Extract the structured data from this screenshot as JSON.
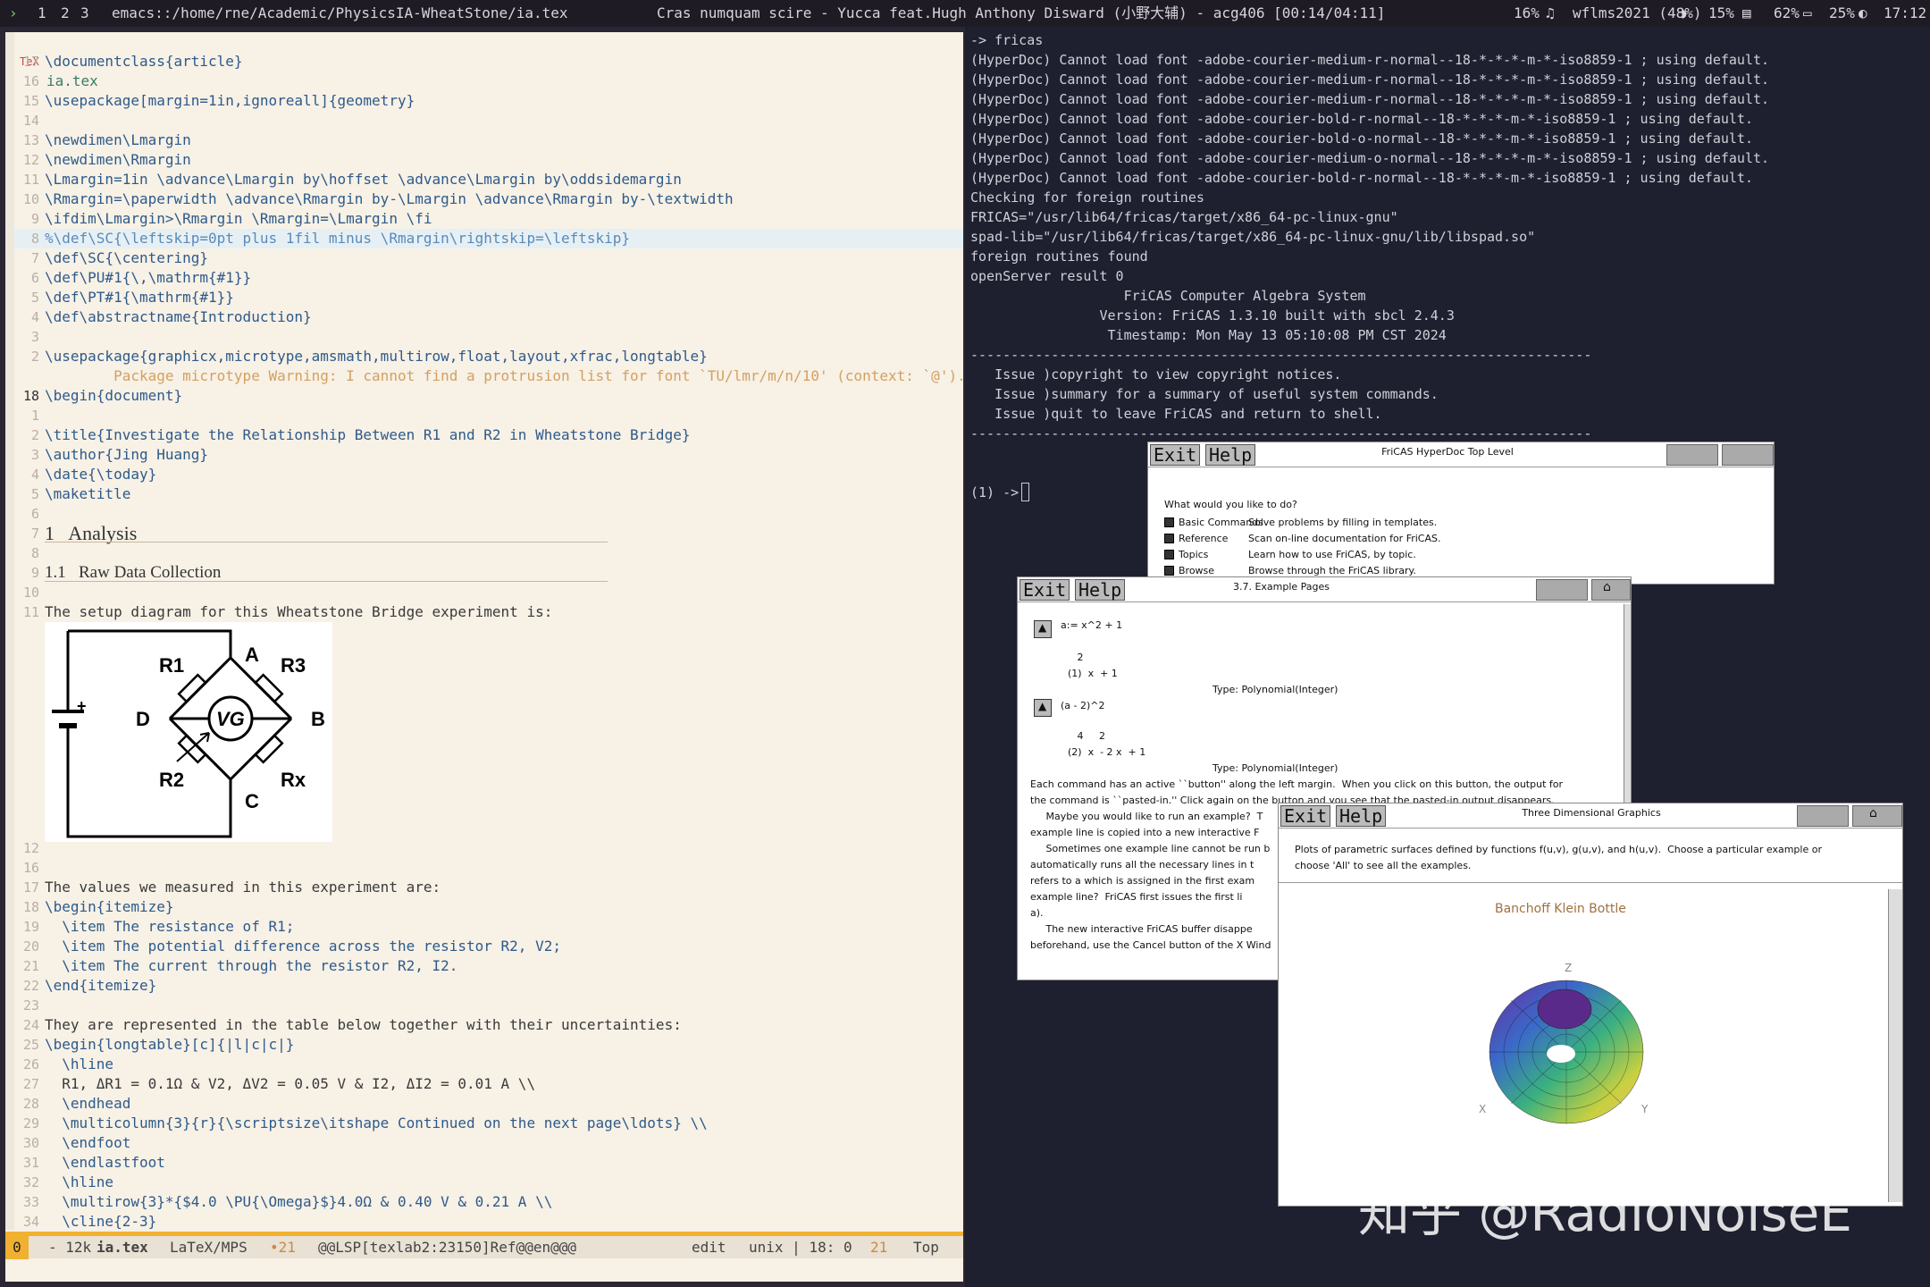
{
  "topbar": {
    "workspaces": [
      "1",
      "2",
      "3"
    ],
    "path": "emacs::/home/rne/Academic/PhysicsIA-WheatStone/ia.tex",
    "song": "Cras numquam scire - Yucca feat.Hugh Anthony Disward (小野大辅) - acg406 [00:14/04:11]",
    "cpu": "16%",
    "wifi": "wflms2021 (48%)",
    "disk": "15%",
    "battery": "62%",
    "bright": "25%",
    "clock": "17:12"
  },
  "editor": {
    "header": {
      "icon": "TeX",
      "filename": "ia.tex"
    },
    "lines": [
      {
        "n": "17",
        "t": "\\documentclass{article}"
      },
      {
        "n": "16",
        "t": ""
      },
      {
        "n": "15",
        "t": "\\usepackage[margin=1in,ignoreall]{geometry}"
      },
      {
        "n": "14",
        "t": ""
      },
      {
        "n": "13",
        "t": "\\newdimen\\Lmargin"
      },
      {
        "n": "12",
        "t": "\\newdimen\\Rmargin"
      },
      {
        "n": "11",
        "t": "\\Lmargin=1in \\advance\\Lmargin by\\hoffset \\advance\\Lmargin by\\oddsidemargin"
      },
      {
        "n": "10",
        "t": "\\Rmargin=\\paperwidth \\advance\\Rmargin by-\\Lmargin \\advance\\Rmargin by-\\textwidth"
      },
      {
        "n": "9",
        "t": "\\ifdim\\Lmargin>\\Rmargin \\Rmargin=\\Lmargin \\fi"
      },
      {
        "n": "8",
        "t": "%\\def\\SC{\\leftskip=0pt plus 1fil minus \\Rmargin\\rightskip=\\leftskip}"
      },
      {
        "n": "7",
        "t": "\\def\\SC{\\centering}"
      },
      {
        "n": "6",
        "t": "\\def\\PU#1{\\,\\mathrm{#1}}"
      },
      {
        "n": "5",
        "t": "\\def\\PT#1{\\mathrm{#1}}"
      },
      {
        "n": "4",
        "t": "\\def\\abstractname{Introduction}"
      },
      {
        "n": "3",
        "t": ""
      },
      {
        "n": "2",
        "t": "\\usepackage{graphicx,microtype,amsmath,multirow,float,layout,xfrac,longtable}"
      },
      {
        "n": "",
        "t": "        Package microtype Warning: I cannot find a protrusion list for font `TU/lmr/m/n/10' (context: `@')."
      },
      {
        "n": "18",
        "t": "\\begin{document}"
      },
      {
        "n": "1",
        "t": ""
      },
      {
        "n": "2",
        "t": "\\title{Investigate the Relationship Between R1 and R2 in Wheatstone Bridge}"
      },
      {
        "n": "3",
        "t": "\\author{Jing Huang}"
      },
      {
        "n": "4",
        "t": "\\date{\\today}"
      },
      {
        "n": "5",
        "t": "\\maketitle"
      },
      {
        "n": "6",
        "t": ""
      },
      {
        "n": "7",
        "t": "1   Analysis"
      },
      {
        "n": "8",
        "t": ""
      },
      {
        "n": "9",
        "t": "1.1   Raw Data Collection"
      },
      {
        "n": "10",
        "t": ""
      },
      {
        "n": "11",
        "t": "The setup diagram for this Wheatstone Bridge experiment is:"
      }
    ],
    "lines2": [
      {
        "n": "12",
        "t": ""
      },
      {
        "n": "16",
        "t": ""
      },
      {
        "n": "17",
        "t": "The values we measured in this experiment are:"
      },
      {
        "n": "18",
        "t": "\\begin{itemize}"
      },
      {
        "n": "19",
        "t": "  \\item The resistance of R1;"
      },
      {
        "n": "20",
        "t": "  \\item The potential difference across the resistor R2, V2;"
      },
      {
        "n": "21",
        "t": "  \\item The current through the resistor R2, I2."
      },
      {
        "n": "22",
        "t": "\\end{itemize}"
      },
      {
        "n": "23",
        "t": ""
      },
      {
        "n": "24",
        "t": "They are represented in the table below together with their uncertainties:"
      },
      {
        "n": "25",
        "t": "\\begin{longtable}[c]{|l|c|c|}"
      },
      {
        "n": "26",
        "t": "  \\hline"
      },
      {
        "n": "27",
        "t": "  R1, ΔR1 = 0.1Ω & V2, ΔV2 = 0.05 V & I2, ΔI2 = 0.01 A \\\\"
      },
      {
        "n": "28",
        "t": "  \\endhead"
      },
      {
        "n": "29",
        "t": "  \\multicolumn{3}{r}{\\scriptsize\\itshape Continued on the next page\\ldots} \\\\"
      },
      {
        "n": "30",
        "t": "  \\endfoot"
      },
      {
        "n": "31",
        "t": "  \\endlastfoot"
      },
      {
        "n": "32",
        "t": "  \\hline"
      },
      {
        "n": "33",
        "t": "  \\multirow{3}*{$4.0 \\PU{\\Omega}$}4.0Ω & 0.40 V & 0.21 A \\\\"
      },
      {
        "n": "34",
        "t": "  \\cline{2-3}"
      }
    ],
    "circuit": {
      "labels": [
        "R1",
        "R3",
        "D",
        "B",
        "VG",
        "R2",
        "Rx",
        "A",
        "C",
        "+"
      ]
    },
    "modeline": {
      "state": "0",
      "size": "- 12k",
      "file": "ia.tex",
      "mode": "LaTeX/MPS",
      "count": "•21",
      "lsp": "@@LSP[texlab2:23150]Ref@@en@@@",
      "edit": "edit",
      "enc": "unix | 18: 0",
      "col": "21",
      "pos": "Top"
    }
  },
  "terminal": {
    "lines": [
      "-> fricas",
      "(HyperDoc) Cannot load font -adobe-courier-medium-r-normal--18-*-*-*-m-*-iso8859-1 ; using default.",
      "(HyperDoc) Cannot load font -adobe-courier-medium-r-normal--18-*-*-*-m-*-iso8859-1 ; using default.",
      "(HyperDoc) Cannot load font -adobe-courier-medium-r-normal--18-*-*-*-m-*-iso8859-1 ; using default.",
      "(HyperDoc) Cannot load font -adobe-courier-bold-r-normal--18-*-*-*-m-*-iso8859-1 ; using default.",
      "(HyperDoc) Cannot load font -adobe-courier-bold-o-normal--18-*-*-*-m-*-iso8859-1 ; using default.",
      "(HyperDoc) Cannot load font -adobe-courier-medium-o-normal--18-*-*-*-m-*-iso8859-1 ; using default.",
      "(HyperDoc) Cannot load font -adobe-courier-bold-r-normal--18-*-*-*-m-*-iso8859-1 ; using default.",
      "Checking for foreign routines",
      "FRICAS=\"/usr/lib64/fricas/target/x86_64-pc-linux-gnu\"",
      "spad-lib=\"/usr/lib64/fricas/target/x86_64-pc-linux-gnu/lib/libspad.so\"",
      "foreign routines found",
      "openServer result 0",
      "                   FriCAS Computer Algebra System",
      "                Version: FriCAS 1.3.10 built with sbcl 2.4.3",
      "                 Timestamp: Mon May 13 05:10:08 PM CST 2024",
      "-----------------------------------------------------------------------------",
      "   Issue )copyright to view copyright notices.",
      "   Issue )summary for a summary of useful system commands.",
      "   Issue )quit to leave FriCAS and return to shell.",
      "-----------------------------------------------------------------------------",
      "",
      "",
      "(1) -> "
    ]
  },
  "hyperdoc": {
    "exit": "Exit",
    "help": "Help",
    "title": "FriCAS HyperDoc Top Level",
    "question": "What would you like to do?",
    "items": [
      {
        "label": "Basic Commands",
        "desc": "Solve problems by filling in templates."
      },
      {
        "label": "Reference",
        "desc": "Scan on-line documentation for FriCAS."
      },
      {
        "label": "Topics",
        "desc": "Learn how to use FriCAS, by topic."
      },
      {
        "label": "Browse",
        "desc": "Browse through the FriCAS library."
      }
    ]
  },
  "examples": {
    "exit": "Exit",
    "help": "Help",
    "title": "3.7.  Example Pages",
    "cmd1": "a:= x^2 + 1",
    "out1a": "       2",
    "out1b": "(1)  x  + 1",
    "type1": "Type: Polynomial(Integer)",
    "cmd2": "(a - 2)^2",
    "out2a": "       4     2",
    "out2b": "(2)  x  - 2 x  + 1",
    "type2": "Type: Polynomial(Integer)",
    "para": [
      "Each command has an active ``button'' along the left margin.  When you click on this button, the output for",
      "the command is ``pasted-in.'' Click again on the button and you see that the pasted-in output disappears.",
      "     Maybe you would like to run an example?  T",
      "example line is copied into a new interactive F",
      "     Sometimes one example line cannot be run b",
      "automatically runs all the necessary lines in t",
      "refers to a which is assigned in the first exam",
      "example line?  FriCAS first issues the first li",
      "a).",
      "     The new interactive FriCAS buffer disappe",
      "beforehand, use the Cancel button of the X Wind"
    ]
  },
  "graphics": {
    "exit": "Exit",
    "help": "Help",
    "title": "Three Dimensional Graphics",
    "desc1": "Plots of parametric surfaces defined by functions f(u,v), g(u,v), and h(u,v).  Choose a particular example or",
    "desc2": "choose 'All' to see all the examples.",
    "plot_title": "Banchoff Klein Bottle",
    "ax_z": "Z",
    "ax_x": "X",
    "ax_y": "Y"
  },
  "watermark": "知乎 @RadioNoiseE"
}
